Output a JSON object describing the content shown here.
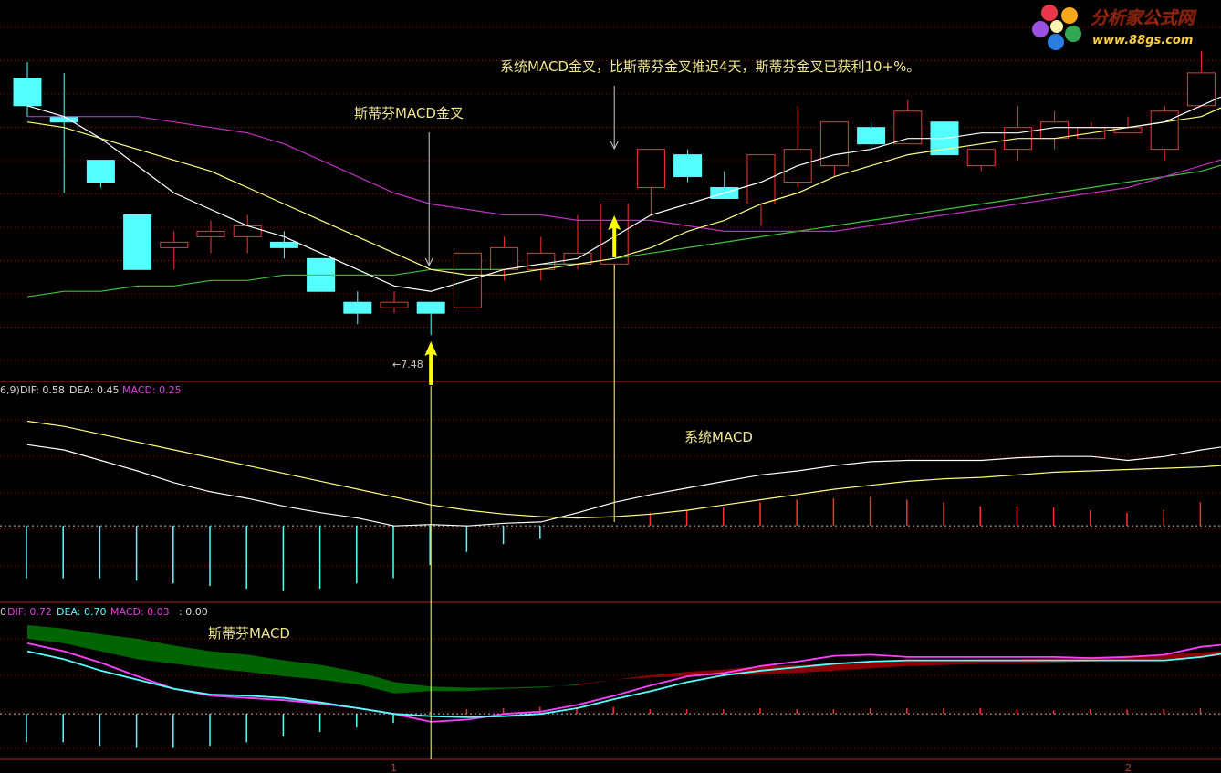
{
  "colors": {
    "background": "#000000",
    "grid": "#8b0000",
    "candle_up": "#ff3030",
    "candle_down": "#54ffff",
    "ma_white": "#ffffff",
    "ma_yellow": "#ffff80",
    "ma_magenta": "#c030c0",
    "ma_green": "#40c040",
    "annotation": "#f0e68c",
    "arrow": "#ffff00",
    "dif": "#ffffff",
    "dea": "#ffff80",
    "macd_pos": "#ff3030",
    "macd_neg": "#54ffff",
    "dif2": "#5ff",
    "dea2": "#ff40ff",
    "band_pos": "#8b0000",
    "band_neg": "#006400"
  },
  "logo": {
    "title": "分析家公式网",
    "url": "www.88gs.com"
  },
  "annotations": {
    "stephen_cross_main": "斯蒂芬MACD金叉",
    "system_cross_main": "系统MACD金叉，比斯蒂芬金叉推迟4天，斯蒂芬金叉已获利10+%。",
    "system_macd": "系统MACD",
    "stephen_macd": "斯蒂芬MACD",
    "low_price": "←7.48"
  },
  "panel2_header": {
    "prefix": "6,9)",
    "dif_label": "DIF: 0.58",
    "dea_label": "DEA: 0.45",
    "macd_label": "MACD: 0.25"
  },
  "panel3_header": {
    "prefix": "0",
    "dif_label": "DIF: 0.72",
    "dea_label": "DEA: 0.70",
    "macd_label": "MACD: 0.03",
    "extra_label": ": 0.00"
  },
  "axis_marks": {
    "mark1": "1",
    "mark2": "2"
  },
  "chart_data": {
    "type": "candlestick",
    "price_ohlc": [
      {
        "o": 7.95,
        "h": 7.98,
        "l": 7.88,
        "c": 7.9
      },
      {
        "o": 7.88,
        "h": 7.96,
        "l": 7.74,
        "c": 7.87
      },
      {
        "o": 7.8,
        "h": 7.8,
        "l": 7.75,
        "c": 7.76
      },
      {
        "o": 7.7,
        "h": 7.7,
        "l": 7.6,
        "c": 7.6
      },
      {
        "o": 7.64,
        "h": 7.67,
        "l": 7.6,
        "c": 7.65
      },
      {
        "o": 7.66,
        "h": 7.69,
        "l": 7.63,
        "c": 7.67
      },
      {
        "o": 7.66,
        "h": 7.7,
        "l": 7.63,
        "c": 7.68
      },
      {
        "o": 7.65,
        "h": 7.67,
        "l": 7.62,
        "c": 7.64
      },
      {
        "o": 7.62,
        "h": 7.62,
        "l": 7.56,
        "c": 7.56
      },
      {
        "o": 7.54,
        "h": 7.56,
        "l": 7.5,
        "c": 7.52
      },
      {
        "o": 7.53,
        "h": 7.56,
        "l": 7.52,
        "c": 7.54
      },
      {
        "o": 7.54,
        "h": 7.54,
        "l": 7.48,
        "c": 7.52
      },
      {
        "o": 7.53,
        "h": 7.63,
        "l": 7.53,
        "c": 7.63
      },
      {
        "o": 7.6,
        "h": 7.66,
        "l": 7.58,
        "c": 7.64
      },
      {
        "o": 7.6,
        "h": 7.66,
        "l": 7.58,
        "c": 7.63
      },
      {
        "o": 7.61,
        "h": 7.7,
        "l": 7.6,
        "c": 7.63
      },
      {
        "o": 7.61,
        "h": 7.65,
        "l": 7.6,
        "c": 7.72
      },
      {
        "o": 7.75,
        "h": 7.82,
        "l": 7.7,
        "c": 7.82
      },
      {
        "o": 7.81,
        "h": 7.82,
        "l": 7.76,
        "c": 7.77
      },
      {
        "o": 7.75,
        "h": 7.78,
        "l": 7.74,
        "c": 7.73
      },
      {
        "o": 7.72,
        "h": 7.81,
        "l": 7.68,
        "c": 7.81
      },
      {
        "o": 7.76,
        "h": 7.9,
        "l": 7.75,
        "c": 7.82
      },
      {
        "o": 7.79,
        "h": 7.87,
        "l": 7.77,
        "c": 7.87
      },
      {
        "o": 7.86,
        "h": 7.87,
        "l": 7.82,
        "c": 7.83
      },
      {
        "o": 7.83,
        "h": 7.91,
        "l": 7.83,
        "c": 7.89
      },
      {
        "o": 7.87,
        "h": 7.87,
        "l": 7.81,
        "c": 7.81
      },
      {
        "o": 7.79,
        "h": 7.82,
        "l": 7.78,
        "c": 7.82
      },
      {
        "o": 7.82,
        "h": 7.9,
        "l": 7.8,
        "c": 7.86
      },
      {
        "o": 7.84,
        "h": 7.89,
        "l": 7.82,
        "c": 7.87
      },
      {
        "o": 7.84,
        "h": 7.87,
        "l": 7.84,
        "c": 7.86
      },
      {
        "o": 7.85,
        "h": 7.88,
        "l": 7.86,
        "c": 7.86
      },
      {
        "o": 7.82,
        "h": 7.9,
        "l": 7.8,
        "c": 7.89
      },
      {
        "o": 7.9,
        "h": 8.0,
        "l": 7.91,
        "c": 7.96
      },
      {
        "o": 7.96,
        "h": 8.02,
        "l": 7.94,
        "c": 8.03
      }
    ],
    "ma_white": [
      7.9,
      7.88,
      7.84,
      7.79,
      7.74,
      7.71,
      7.68,
      7.66,
      7.63,
      7.6,
      7.57,
      7.56,
      7.58,
      7.6,
      7.61,
      7.62,
      7.66,
      7.7,
      7.72,
      7.74,
      7.76,
      7.79,
      7.81,
      7.82,
      7.84,
      7.84,
      7.85,
      7.85,
      7.86,
      7.86,
      7.86,
      7.87,
      7.9,
      7.93
    ],
    "ma_yellow": [
      7.87,
      7.86,
      7.84,
      7.82,
      7.8,
      7.78,
      7.75,
      7.72,
      7.69,
      7.66,
      7.63,
      7.6,
      7.59,
      7.59,
      7.6,
      7.61,
      7.62,
      7.64,
      7.67,
      7.69,
      7.72,
      7.74,
      7.77,
      7.79,
      7.81,
      7.82,
      7.83,
      7.84,
      7.84,
      7.85,
      7.86,
      7.87,
      7.88,
      7.91
    ],
    "ma_magenta": [
      7.88,
      7.88,
      7.88,
      7.88,
      7.87,
      7.86,
      7.85,
      7.83,
      7.8,
      7.77,
      7.74,
      7.72,
      7.71,
      7.7,
      7.7,
      7.69,
      7.69,
      7.69,
      7.68,
      7.67,
      7.67,
      7.67,
      7.67,
      7.68,
      7.69,
      7.7,
      7.71,
      7.72,
      7.73,
      7.74,
      7.75,
      7.77,
      7.79,
      7.81
    ],
    "ma_green": [
      7.55,
      7.56,
      7.56,
      7.57,
      7.57,
      7.58,
      7.58,
      7.59,
      7.59,
      7.59,
      7.59,
      7.6,
      7.6,
      7.6,
      7.61,
      7.61,
      7.62,
      7.63,
      7.64,
      7.65,
      7.66,
      7.67,
      7.68,
      7.69,
      7.7,
      7.71,
      7.72,
      7.73,
      7.74,
      7.75,
      7.76,
      7.77,
      7.78,
      7.8
    ],
    "system_macd": {
      "dif": [
        0.62,
        0.58,
        0.5,
        0.42,
        0.33,
        0.26,
        0.21,
        0.15,
        0.1,
        0.06,
        0.0,
        0.01,
        0.0,
        0.02,
        0.03,
        0.1,
        0.18,
        0.24,
        0.29,
        0.34,
        0.39,
        0.42,
        0.46,
        0.49,
        0.5,
        0.5,
        0.5,
        0.52,
        0.53,
        0.53,
        0.5,
        0.53,
        0.58,
        0.62
      ],
      "dea": [
        0.8,
        0.76,
        0.7,
        0.64,
        0.58,
        0.52,
        0.46,
        0.4,
        0.34,
        0.28,
        0.22,
        0.16,
        0.12,
        0.09,
        0.07,
        0.06,
        0.07,
        0.09,
        0.12,
        0.16,
        0.2,
        0.24,
        0.28,
        0.31,
        0.34,
        0.36,
        0.37,
        0.39,
        0.41,
        0.42,
        0.43,
        0.44,
        0.45,
        0.47
      ],
      "hist": [
        -0.4,
        -0.4,
        -0.4,
        -0.42,
        -0.44,
        -0.46,
        -0.48,
        -0.5,
        -0.48,
        -0.44,
        -0.4,
        -0.3,
        -0.2,
        -0.14,
        -0.1,
        0.0,
        0.0,
        0.1,
        0.12,
        0.14,
        0.18,
        0.2,
        0.21,
        0.22,
        0.2,
        0.18,
        0.15,
        0.15,
        0.14,
        0.12,
        0.1,
        0.12,
        0.18,
        0.25
      ]
    },
    "stephen_macd": {
      "dif": [
        0.55,
        0.48,
        0.38,
        0.3,
        0.22,
        0.17,
        0.16,
        0.14,
        0.1,
        0.05,
        0.0,
        -0.02,
        -0.03,
        -0.02,
        0.0,
        0.05,
        0.13,
        0.2,
        0.28,
        0.34,
        0.38,
        0.41,
        0.44,
        0.46,
        0.47,
        0.47,
        0.47,
        0.47,
        0.47,
        0.47,
        0.47,
        0.47,
        0.5,
        0.55
      ],
      "dea": [
        0.62,
        0.55,
        0.45,
        0.33,
        0.22,
        0.16,
        0.14,
        0.12,
        0.09,
        0.05,
        0.0,
        -0.07,
        -0.05,
        0.0,
        0.02,
        0.08,
        0.16,
        0.25,
        0.33,
        0.36,
        0.42,
        0.46,
        0.51,
        0.52,
        0.5,
        0.5,
        0.5,
        0.5,
        0.5,
        0.49,
        0.5,
        0.52,
        0.59,
        0.62
      ],
      "band_upper": [
        0.78,
        0.75,
        0.7,
        0.66,
        0.6,
        0.55,
        0.52,
        0.47,
        0.43,
        0.37,
        0.28,
        0.24,
        0.23,
        0.23,
        0.24,
        0.25,
        0.3,
        0.34,
        0.37,
        0.39,
        0.42,
        0.43,
        0.44,
        0.45,
        0.48,
        0.47,
        0.48,
        0.48,
        0.49,
        0.5,
        0.51,
        0.52,
        0.54,
        0.56
      ],
      "band_lower": [
        0.66,
        0.62,
        0.55,
        0.48,
        0.44,
        0.4,
        0.37,
        0.33,
        0.3,
        0.26,
        0.18,
        0.2,
        0.2,
        0.22,
        0.23,
        0.26,
        0.3,
        0.32,
        0.33,
        0.34,
        0.35,
        0.36,
        0.38,
        0.4,
        0.42,
        0.43,
        0.44,
        0.44,
        0.45,
        0.46,
        0.47,
        0.48,
        0.5,
        0.52
      ],
      "hist": [
        -0.25,
        -0.25,
        -0.28,
        -0.3,
        -0.3,
        -0.28,
        -0.25,
        -0.2,
        -0.16,
        -0.12,
        -0.08,
        0.02,
        0.04,
        0.05,
        0.06,
        0.06,
        0.06,
        0.04,
        0.04,
        0.04,
        0.05,
        0.04,
        0.04,
        0.05,
        0.05,
        0.05,
        0.05,
        0.04,
        0.03,
        0.04,
        0.04,
        0.04,
        0.05,
        0.06
      ]
    },
    "stephen_cross_index": 11,
    "system_cross_index": 16
  }
}
